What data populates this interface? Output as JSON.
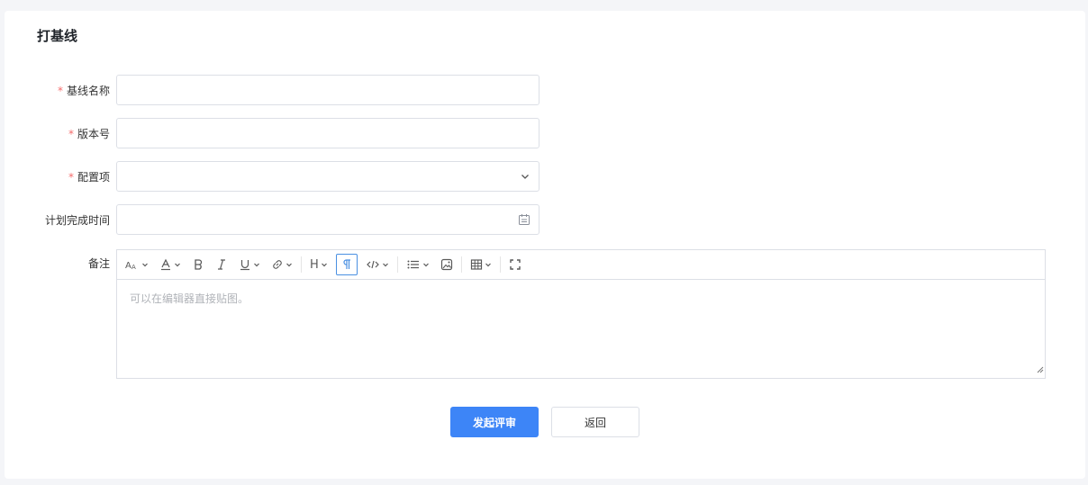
{
  "page": {
    "title": "打基线"
  },
  "form": {
    "required_mark": "*",
    "baseline_name": {
      "label": "基线名称",
      "value": "",
      "placeholder": ""
    },
    "version": {
      "label": "版本号",
      "value": "",
      "placeholder": ""
    },
    "config_item": {
      "label": "配置项",
      "selected": "",
      "icon": "chevron-down-icon"
    },
    "planned_time": {
      "label": "计划完成时间",
      "value": "",
      "placeholder": "",
      "icon": "calendar-icon"
    },
    "remark": {
      "label": "备注",
      "placeholder": "可以在编辑器直接贴图。"
    }
  },
  "toolbar": {
    "heading_label": "H",
    "items": [
      "font-size-icon",
      "font-color-icon",
      "bold-icon",
      "italic-icon",
      "underline-icon",
      "link-icon",
      "heading-icon",
      "paragraph-icon",
      "code-icon",
      "list-icon",
      "image-icon",
      "table-icon",
      "fullscreen-icon"
    ]
  },
  "actions": {
    "submit_label": "发起评审",
    "back_label": "返回"
  },
  "colors": {
    "primary": "#3d85f7",
    "required": "#f56c6c",
    "border": "#dcdfe6",
    "active": "#4a90e2"
  }
}
